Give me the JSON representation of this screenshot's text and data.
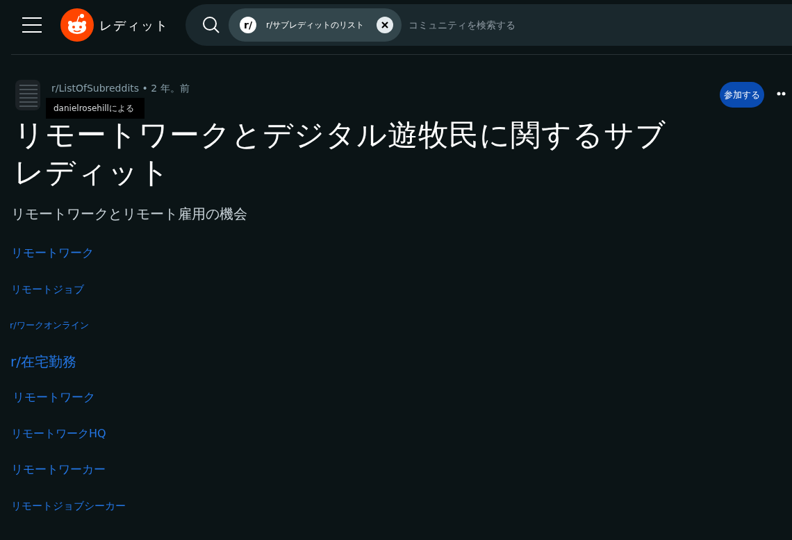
{
  "header": {
    "logo_text": "レディット",
    "search": {
      "chip_label": "r/",
      "chip_text": "r/サブレディットのリスト",
      "placeholder": "コミュニティを検索する"
    }
  },
  "post": {
    "meta": "r/ListOfSubreddits • 2 年。前",
    "tooltip": "danielrosehillによる",
    "join_button": "参加する",
    "title": "リモートワークとデジタル遊牧民に関するサブレディット",
    "subheading": "リモートワークとリモート雇用の機会",
    "links": [
      "リモートワーク",
      "リモートジョブ",
      "r/ワークオンライン",
      "r/在宅勤務",
      "リモートワーク",
      "リモートワークHQ",
      "リモートワーカー",
      "リモートジョブシーカー"
    ]
  }
}
